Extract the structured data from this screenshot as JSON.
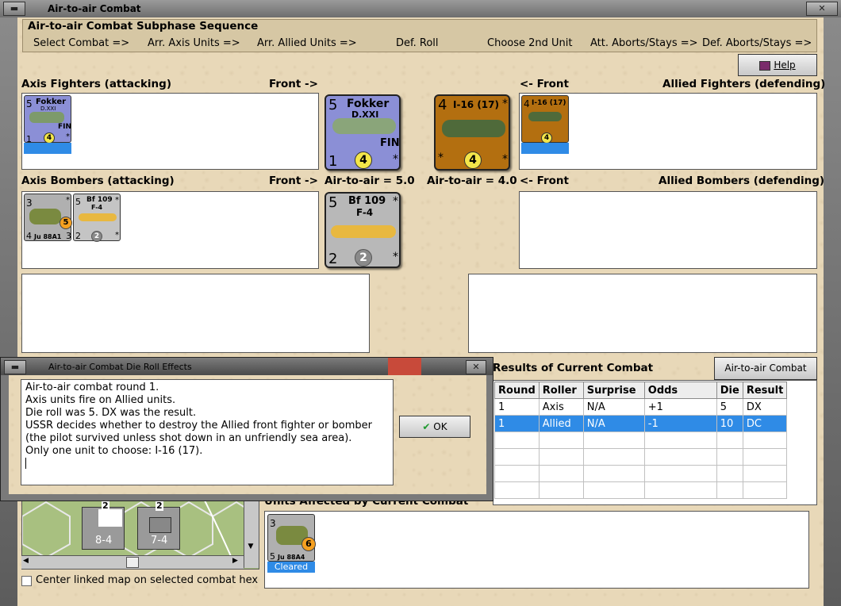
{
  "window": {
    "title": "Air-to-air Combat"
  },
  "sequence": {
    "title": "Air-to-air Combat Subphase Sequence",
    "steps": [
      "Select Combat =>",
      "Arr. Axis Units =>",
      "Arr. Allied Units =>",
      "Def. Roll",
      "Choose 2nd Unit",
      "Att. Aborts/Stays =>",
      "Def. Aborts/Stays =>"
    ]
  },
  "help_label": "Help",
  "panels": {
    "axis_fighters": "Axis Fighters (attacking)",
    "front_right": "Front ->",
    "front_left": "<- Front",
    "allied_fighters": "Allied Fighters (defending)",
    "axis_bombers": "Axis Bombers (attacking)",
    "allied_bombers": "Allied Bombers (defending)",
    "axis_air_to_air": "Air-to-air = 5.0",
    "allied_air_to_air": "Air-to-air = 4.0"
  },
  "counters": {
    "fokker": {
      "tl": "5",
      "name": "Fokker",
      "sub": "D.XXI",
      "nat": "FIN",
      "bl": "1",
      "circle": "4",
      "star": "*"
    },
    "i16": {
      "tl": "4",
      "name": "I-16 (17)",
      "circle": "4",
      "star": "*"
    },
    "ju88_small": {
      "tl": "3",
      "bl": "4",
      "name": "Ju 88A1",
      "br": "3",
      "circle": "5",
      "star": "*"
    },
    "bf109": {
      "tl": "5",
      "name": "Bf 109",
      "sub": "F-4",
      "bl": "2",
      "circle": "2",
      "star": "*"
    },
    "ju88_cleared": {
      "tl": "3",
      "bl": "5",
      "name": "Ju 88A4",
      "circle": "6",
      "tag": "Cleared"
    }
  },
  "dialog": {
    "title": "Air-to-air Combat Die Roll Effects",
    "lines": [
      "Air-to-air combat round 1.",
      "Axis units fire on Allied units.",
      "Die roll was 5.  DX was the result.",
      "USSR decides whether to destroy the Allied front fighter or bomber",
      "(the pilot survived unless shot down in an unfriendly sea area).",
      "Only one unit to choose: I-16 (17)."
    ],
    "ok_label": "OK"
  },
  "results": {
    "title": "Results of Current Combat",
    "chart_button": "Air-to-air Combat Chart",
    "columns": [
      "Round",
      "Roller",
      "Surprise",
      "Odds",
      "Die",
      "Result"
    ],
    "rows": [
      [
        "1",
        "Axis",
        "N/A",
        "+1",
        "5",
        "DX"
      ],
      [
        "1",
        "Allied",
        "N/A",
        "-1",
        "10",
        "DC"
      ]
    ]
  },
  "units_affected": {
    "title": "Units Affected by Current Combat"
  },
  "map": {
    "unit1": {
      "size": "XXX",
      "str": "8-4",
      "top": "2"
    },
    "unit2": {
      "size": "XXX",
      "str": "7-4",
      "top": "2"
    },
    "checkbox_label": "Center linked map on selected combat hex"
  },
  "colors": {
    "sand": "#e8d8b8",
    "axis_fighter": "#8b8fd6",
    "allied_fighter": "#b36f10",
    "axis_bomber": "#b0b0b0",
    "selected": "#2f8be6"
  }
}
